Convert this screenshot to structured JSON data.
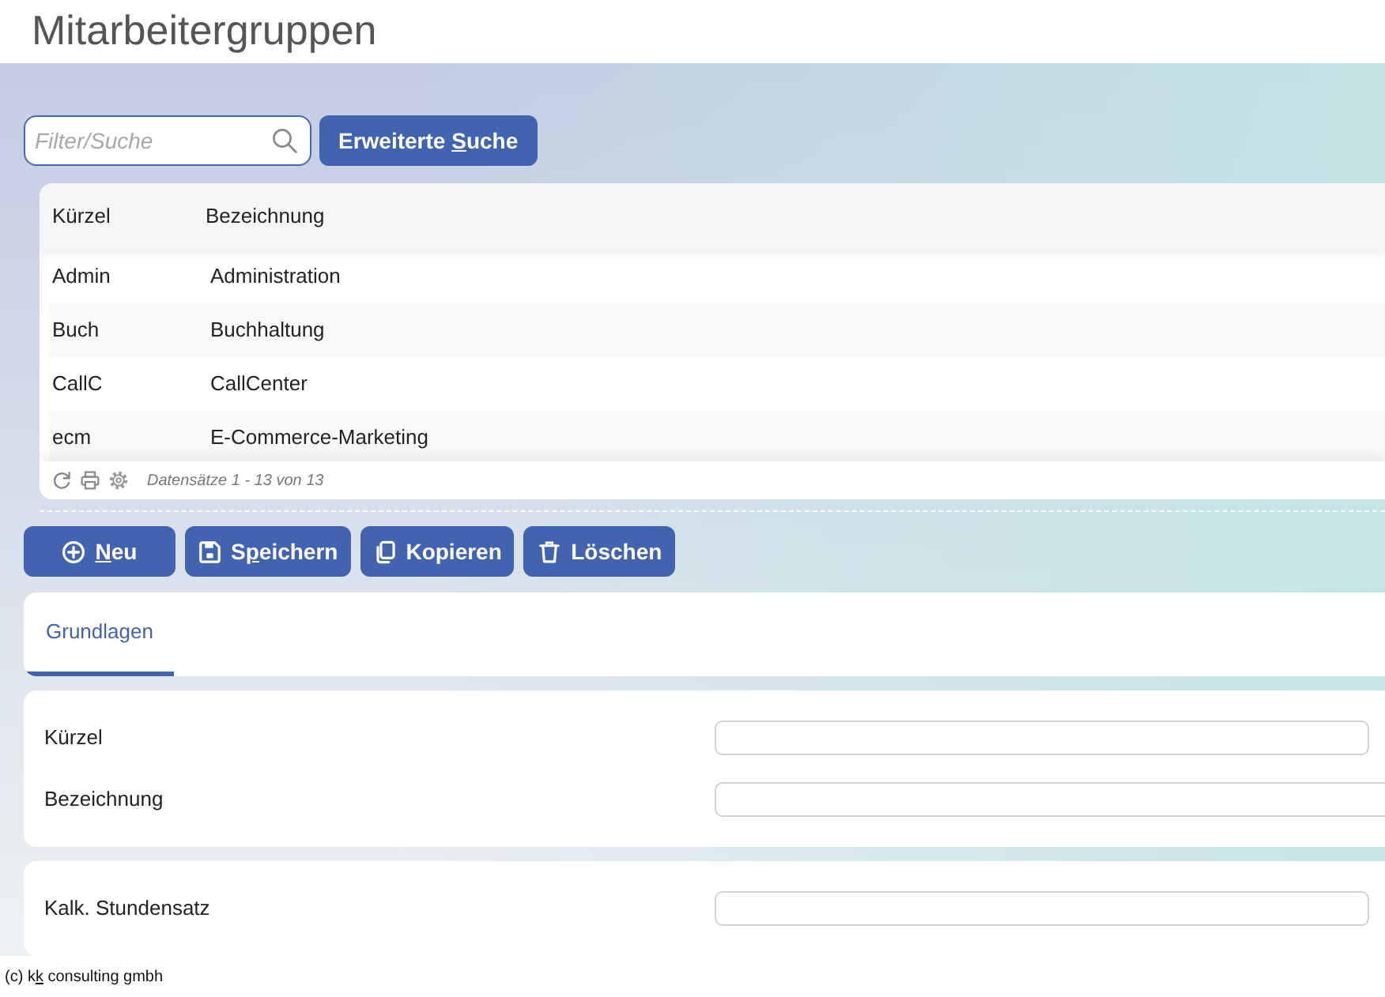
{
  "title": "Mitarbeitergruppen",
  "search": {
    "placeholder": "Filter/Suche"
  },
  "advanced_search_button": {
    "before": "Erweiterte ",
    "access_key": "S",
    "after": "uche"
  },
  "table": {
    "columns": [
      "Kürzel",
      "Bezeichnung"
    ],
    "rows": [
      [
        "Admin",
        "Administration"
      ],
      [
        "Buch",
        "Buchhaltung"
      ],
      [
        "CallC",
        "CallCenter"
      ],
      [
        "ecm",
        "E-Commerce-Marketing"
      ]
    ],
    "record_info": "Datensätze 1 - 13 von 13"
  },
  "actions": [
    {
      "kind": "new",
      "access_key": "N",
      "after": "eu"
    },
    {
      "kind": "save",
      "before": "S",
      "access_key": "p",
      "after": "eichern"
    },
    {
      "kind": "copy",
      "before": "Kopieren"
    },
    {
      "kind": "delete",
      "before": "Löschen"
    }
  ],
  "tabs": [
    {
      "label": "Grundlagen",
      "selected": true
    }
  ],
  "sections": [
    {
      "fields": [
        {
          "label": "Kürzel",
          "wide": false
        },
        {
          "label": "Bezeichnung",
          "wide": true
        }
      ]
    },
    {
      "fields": [
        {
          "label": "Kalk. Stundensatz",
          "wide": false
        }
      ]
    }
  ],
  "footer": {
    "before": "(c) k",
    "access_key": "k",
    "after": " consulting gmbh"
  }
}
